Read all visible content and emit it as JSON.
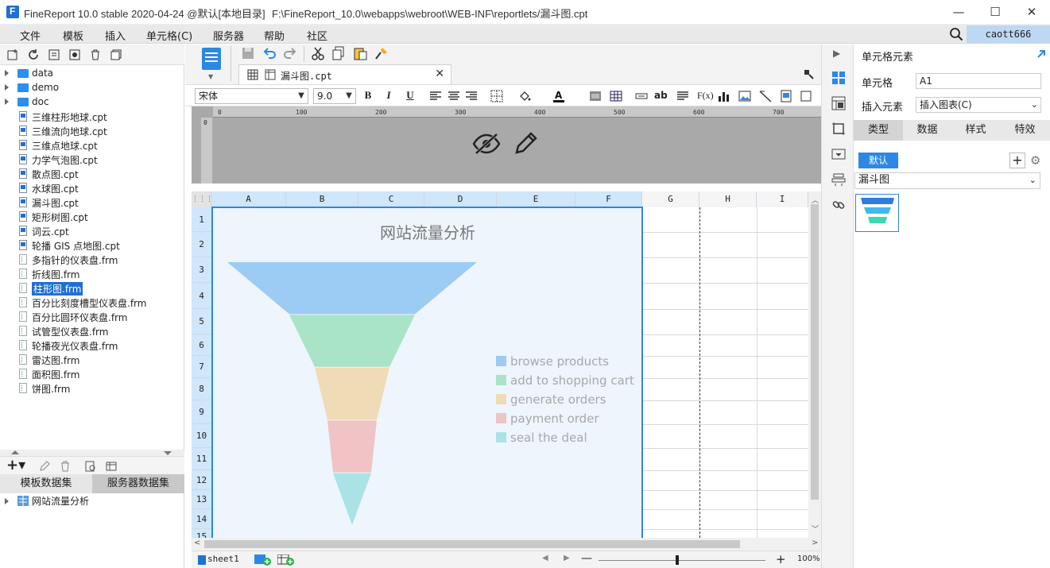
{
  "window": {
    "title": "FineReport 10.0 stable 2020-04-24 @默认[本地目录]",
    "path": "F:\\FineReport_10.0\\webapps\\webroot\\WEB-INF\\reportlets/漏斗图.cpt"
  },
  "menu": [
    "文件",
    "模板",
    "插入",
    "单元格(C)",
    "服务器",
    "帮助",
    "社区"
  ],
  "user": "caott666",
  "tree": [
    {
      "label": "data",
      "type": "folder"
    },
    {
      "label": "demo",
      "type": "folder"
    },
    {
      "label": "doc",
      "type": "folder"
    },
    {
      "label": "三维柱形地球.cpt",
      "type": "cpt"
    },
    {
      "label": "三维流向地球.cpt",
      "type": "cpt"
    },
    {
      "label": "三维点地球.cpt",
      "type": "cpt"
    },
    {
      "label": "力学气泡图.cpt",
      "type": "cpt"
    },
    {
      "label": "散点图.cpt",
      "type": "cpt"
    },
    {
      "label": "水球图.cpt",
      "type": "cpt"
    },
    {
      "label": "漏斗图.cpt",
      "type": "cpt"
    },
    {
      "label": "矩形树图.cpt",
      "type": "cpt"
    },
    {
      "label": "词云.cpt",
      "type": "cpt"
    },
    {
      "label": "轮播 GIS 点地图.cpt",
      "type": "cpt"
    },
    {
      "label": "多指针的仪表盘.frm",
      "type": "frm"
    },
    {
      "label": "折线图.frm",
      "type": "frm"
    },
    {
      "label": "柱形图.frm",
      "type": "frm",
      "selected": true
    },
    {
      "label": "百分比刻度槽型仪表盘.frm",
      "type": "frm"
    },
    {
      "label": "百分比圆环仪表盘.frm",
      "type": "frm"
    },
    {
      "label": "试管型仪表盘.frm",
      "type": "frm"
    },
    {
      "label": "轮播夜光仪表盘.frm",
      "type": "frm"
    },
    {
      "label": "雷达图.frm",
      "type": "frm"
    },
    {
      "label": "面积图.frm",
      "type": "frm"
    },
    {
      "label": "饼图.frm",
      "type": "frm"
    }
  ],
  "dataset_tabs": [
    "模板数据集",
    "服务器数据集"
  ],
  "dataset_item": "网站流量分析",
  "file_tab": "漏斗图.cpt",
  "font": {
    "family": "宋体",
    "size": "9.0"
  },
  "ruler_ticks": [
    "0",
    "100",
    "200",
    "300",
    "400",
    "500",
    "600",
    "700"
  ],
  "columns": [
    "A",
    "B",
    "C",
    "D",
    "E",
    "F",
    "G",
    "H",
    "I"
  ],
  "rows": [
    "1",
    "2",
    "3",
    "4",
    "5",
    "6",
    "7",
    "8",
    "9",
    "10",
    "11",
    "12",
    "13",
    "14",
    "15"
  ],
  "chart_data": {
    "type": "funnel",
    "title": "网站流量分析",
    "categories": [
      "browse products",
      "add to shopping cart",
      "generate orders",
      "payment order",
      "seal the deal"
    ],
    "colors": [
      "#9ccbf3",
      "#a9e4c6",
      "#efdcb6",
      "#f0c3c4",
      "#a9e3e6"
    ],
    "legend_position": "right"
  },
  "sheet_tab": "sheet1",
  "zoom": "100%",
  "right_panel": {
    "header": "单元格元素",
    "cell_label": "单元格",
    "cell_value": "A1",
    "insert_label": "插入元素",
    "insert_value": "插入图表(C)",
    "tabs": [
      "类型",
      "数据",
      "样式",
      "特效"
    ],
    "default_button": "默认",
    "chart_type": "漏斗图"
  }
}
